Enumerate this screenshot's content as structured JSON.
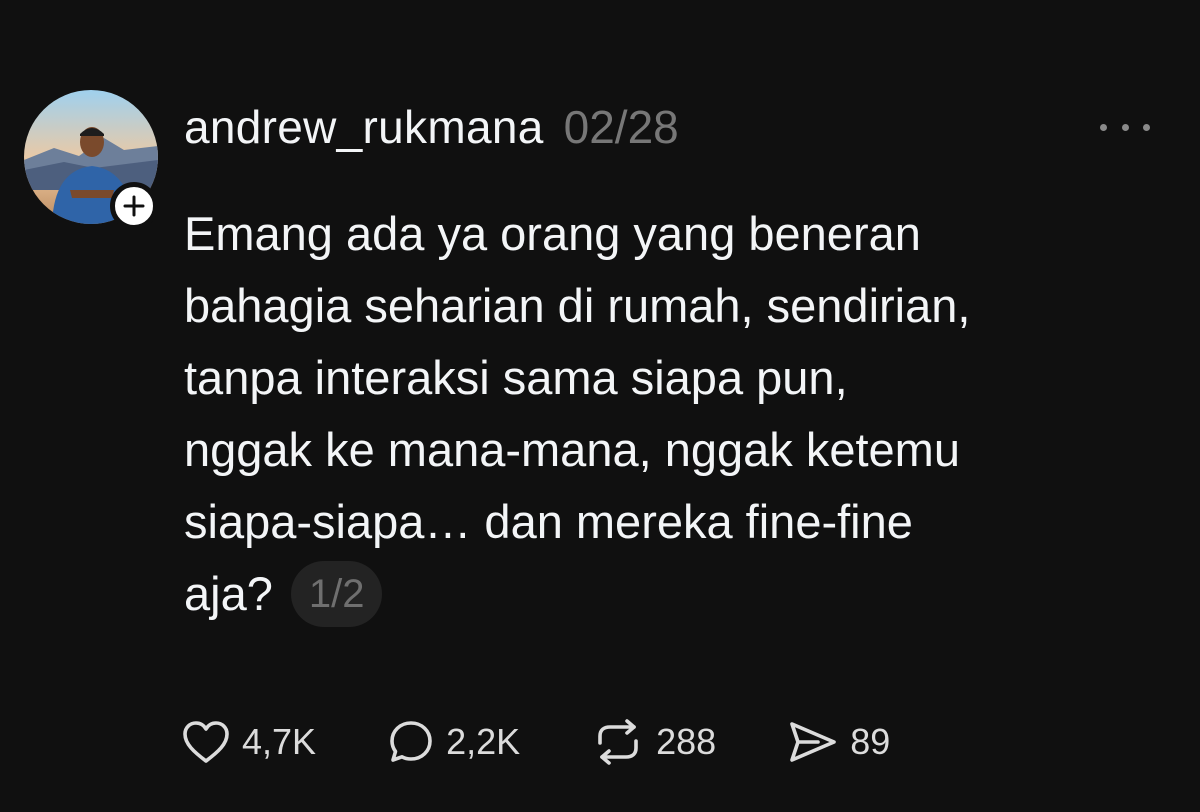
{
  "author": {
    "username": "andrew_rukmana",
    "date": "02/28"
  },
  "post": {
    "lines": [
      "Emang ada ya orang yang beneran",
      "bahagia seharian di rumah, sendirian,",
      "tanpa interaksi sama siapa pun,",
      "nggak ke mana-mana, nggak ketemu",
      "siapa-siapa… dan mereka fine-fine",
      "aja?"
    ],
    "page_indicator": "1/2"
  },
  "actions": {
    "likes": "4,7K",
    "replies": "2,2K",
    "reposts": "288",
    "shares": "89"
  },
  "icons": {
    "follow": "plus-icon",
    "more": "more-dots-icon",
    "like": "heart-icon",
    "reply": "comment-bubble-icon",
    "repost": "repost-icon",
    "share": "send-icon"
  },
  "colors": {
    "background": "#101010",
    "text": "#f3f5f7",
    "muted": "#777777"
  }
}
